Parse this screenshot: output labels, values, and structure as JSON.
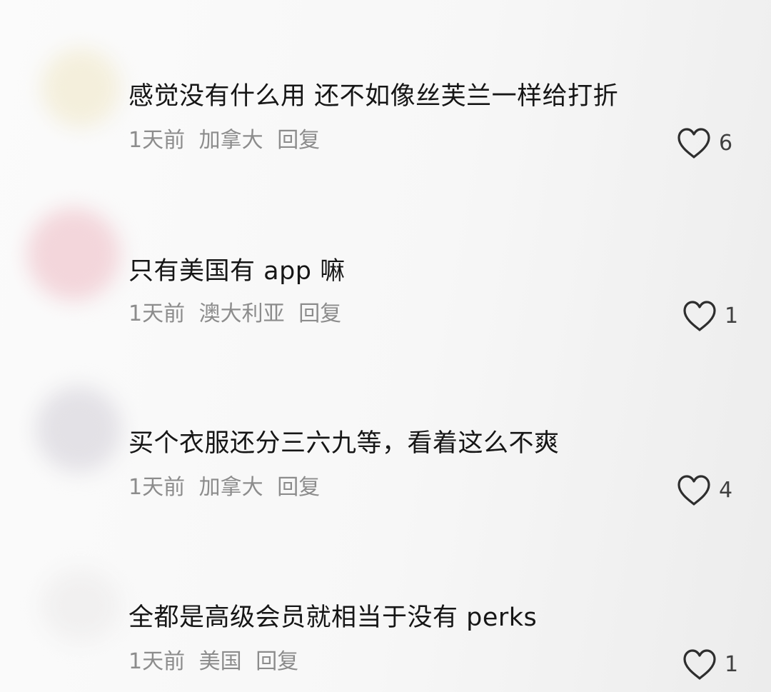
{
  "comments": [
    {
      "text": "感觉没有什么用 还不如像丝芙兰一样给打折",
      "time": "1天前",
      "location": "加拿大",
      "reply": "回复",
      "likes": "6"
    },
    {
      "text": "只有美国有 app 嘛",
      "time": "1天前",
      "location": "澳大利亚",
      "reply": "回复",
      "likes": "1"
    },
    {
      "text": "买个衣服还分三六九等，看着这么不爽",
      "time": "1天前",
      "location": "加拿大",
      "reply": "回复",
      "likes": "4"
    },
    {
      "text": "全都是高级会员就相当于没有 perks",
      "time": "1天前",
      "location": "美国",
      "reply": "回复",
      "likes": "1"
    }
  ],
  "icons": {
    "like": "heart-outline-icon",
    "avatar": "blurred-avatar"
  },
  "colors": {
    "text": "#161616",
    "meta": "#8c8c8c",
    "avatar_1": "#f3eedd",
    "avatar_2": "#f4d9dd",
    "avatar_3": "#e4e2e6"
  }
}
